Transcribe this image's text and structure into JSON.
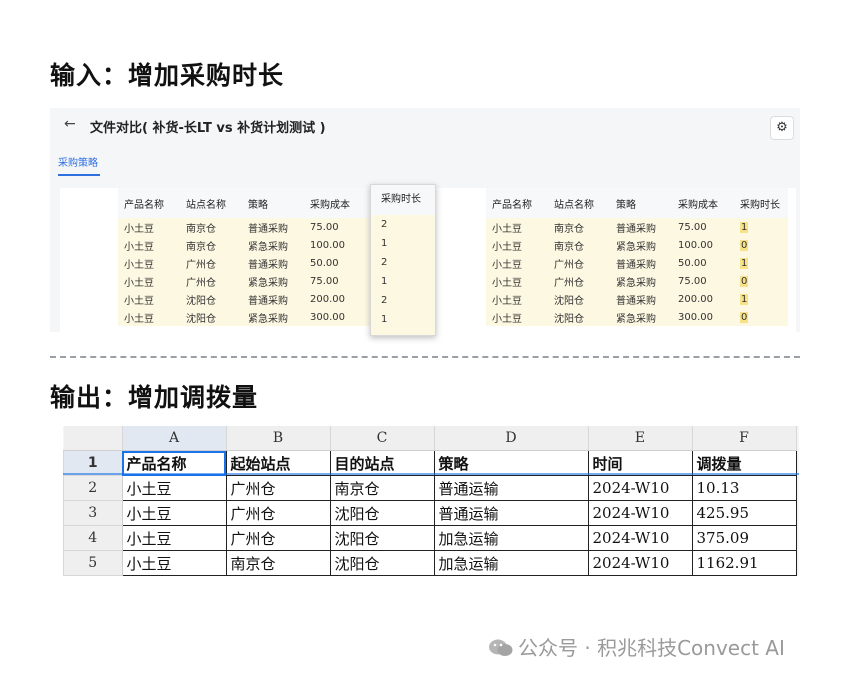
{
  "headings": {
    "input": "输入：增加采购时长",
    "output": "输出：增加调拨量"
  },
  "input_panel": {
    "title": "文件对比( 补货-长LT vs 补货计划测试 )",
    "tab": "采购策略",
    "left_table": {
      "columns": [
        "产品名称",
        "站点名称",
        "策略",
        "采购成本"
      ],
      "rows": [
        [
          "小土豆",
          "南京仓",
          "普通采购",
          "75.00"
        ],
        [
          "小土豆",
          "南京仓",
          "紧急采购",
          "100.00"
        ],
        [
          "小土豆",
          "广州仓",
          "普通采购",
          "50.00"
        ],
        [
          "小土豆",
          "广州仓",
          "紧急采购",
          "75.00"
        ],
        [
          "小土豆",
          "沈阳仓",
          "普通采购",
          "200.00"
        ],
        [
          "小土豆",
          "沈阳仓",
          "紧急采购",
          "300.00"
        ]
      ]
    },
    "popout": {
      "header": "采购时长",
      "values": [
        "2",
        "1",
        "2",
        "1",
        "2",
        "1"
      ]
    },
    "right_table": {
      "columns": [
        "产品名称",
        "站点名称",
        "策略",
        "采购成本",
        "采购时长"
      ],
      "rows": [
        [
          "小土豆",
          "南京仓",
          "普通采购",
          "75.00",
          "1"
        ],
        [
          "小土豆",
          "南京仓",
          "紧急采购",
          "100.00",
          "0"
        ],
        [
          "小土豆",
          "广州仓",
          "普通采购",
          "50.00",
          "1"
        ],
        [
          "小土豆",
          "广州仓",
          "紧急采购",
          "75.00",
          "0"
        ],
        [
          "小土豆",
          "沈阳仓",
          "普通采购",
          "200.00",
          "1"
        ],
        [
          "小土豆",
          "沈阳仓",
          "紧急采购",
          "300.00",
          "0"
        ]
      ]
    }
  },
  "output_sheet": {
    "col_letters": [
      "A",
      "B",
      "C",
      "D",
      "E",
      "F"
    ],
    "row_numbers": [
      "1",
      "2",
      "3",
      "4",
      "5"
    ],
    "header": [
      "产品名称",
      "起始站点",
      "目的站点",
      "策略",
      "时间",
      "调拨量"
    ],
    "rows": [
      [
        "小土豆",
        "广州仓",
        "南京仓",
        "普通运输",
        "2024-W10",
        "10.13"
      ],
      [
        "小土豆",
        "广州仓",
        "沈阳仓",
        "普通运输",
        "2024-W10",
        "425.95"
      ],
      [
        "小土豆",
        "广州仓",
        "沈阳仓",
        "加急运输",
        "2024-W10",
        "375.09"
      ],
      [
        "小土豆",
        "南京仓",
        "沈阳仓",
        "加急运输",
        "2024-W10",
        "1162.91"
      ]
    ]
  },
  "watermark": "公众号 · 积兆科技Convect AI"
}
